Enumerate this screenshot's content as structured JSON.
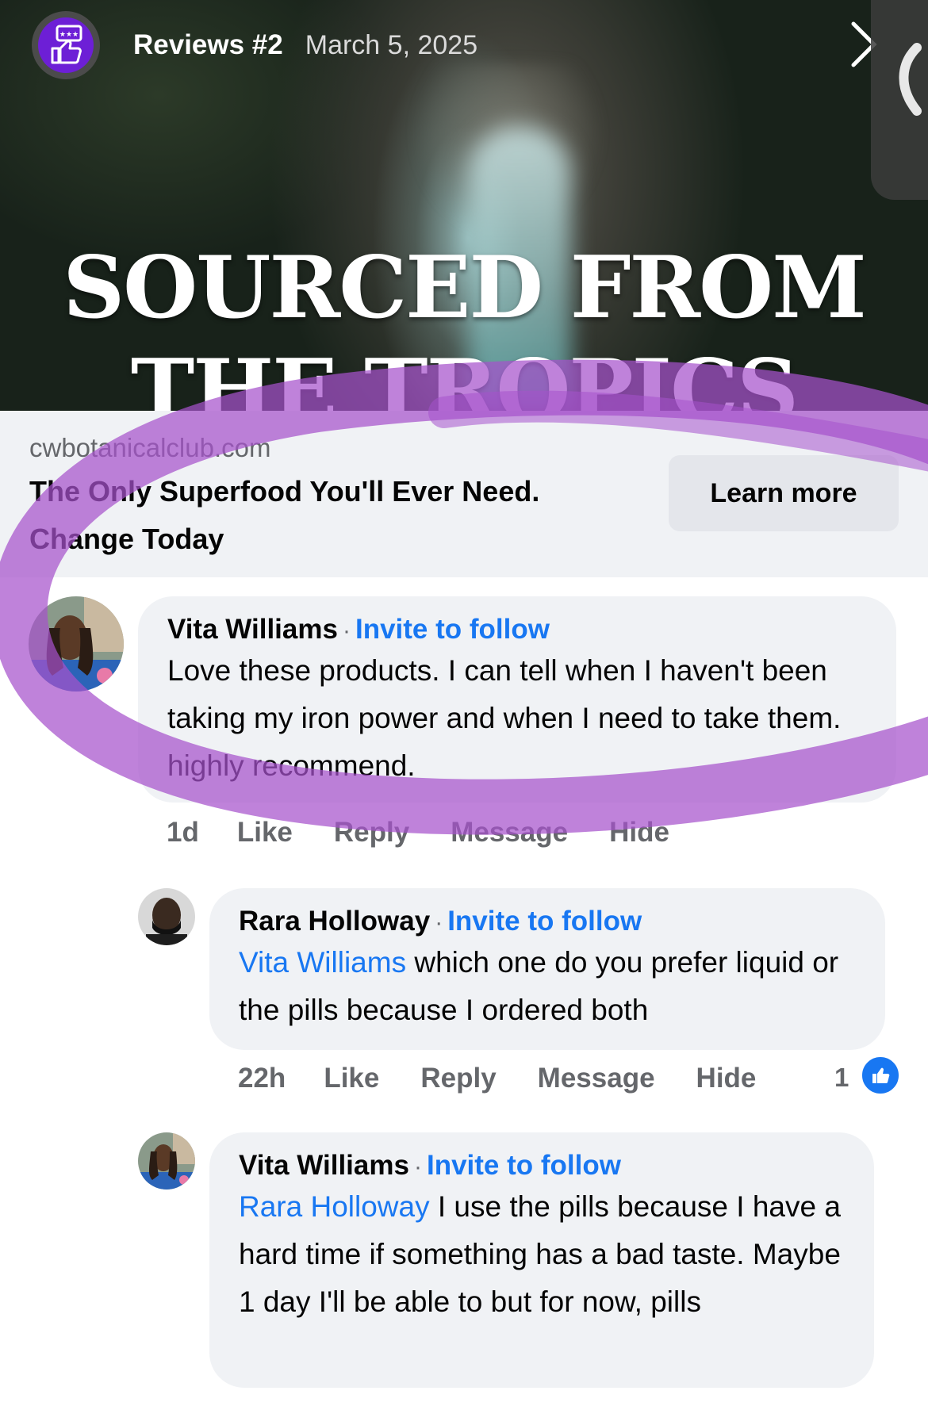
{
  "story": {
    "title": "Reviews #2",
    "date": "March 5, 2025",
    "hero_text_line1": "SOURCED FROM",
    "hero_text_line2": "THE TROPICS",
    "close_icon": "chevron-right-icon",
    "side_tab_icon": "chevron-left-icon"
  },
  "link_preview": {
    "domain": "cwbotanicalclub.com",
    "headline": "The Only Superfood You'll Ever Need. Change Today",
    "button_label": "Learn more"
  },
  "comments": [
    {
      "author": "Vita Williams",
      "follow_label": "Invite to follow",
      "text": "Love these products. I can tell when I haven't been taking my iron power and when I need to take them.  highly recommend.",
      "time": "1d",
      "actions": [
        "Like",
        "Reply",
        "Message",
        "Hide"
      ]
    },
    {
      "author": "Rara Holloway",
      "follow_label": "Invite to follow",
      "mention": "Vita Williams",
      "text": " which one do you prefer liquid or the pills because I ordered both",
      "time": "22h",
      "actions": [
        "Like",
        "Reply",
        "Message",
        "Hide"
      ],
      "reaction_count": "1"
    },
    {
      "author": "Vita Williams",
      "follow_label": "Invite to follow",
      "mention": "Rara Holloway",
      "text": " I use the pills because I have a hard time if something has a bad taste. Maybe 1 day I'll be able to but for now, pills"
    }
  ],
  "colors": {
    "link_blue": "#1877f2",
    "bubble_bg": "#f0f2f5",
    "annotation_purple": "#a652cc"
  }
}
